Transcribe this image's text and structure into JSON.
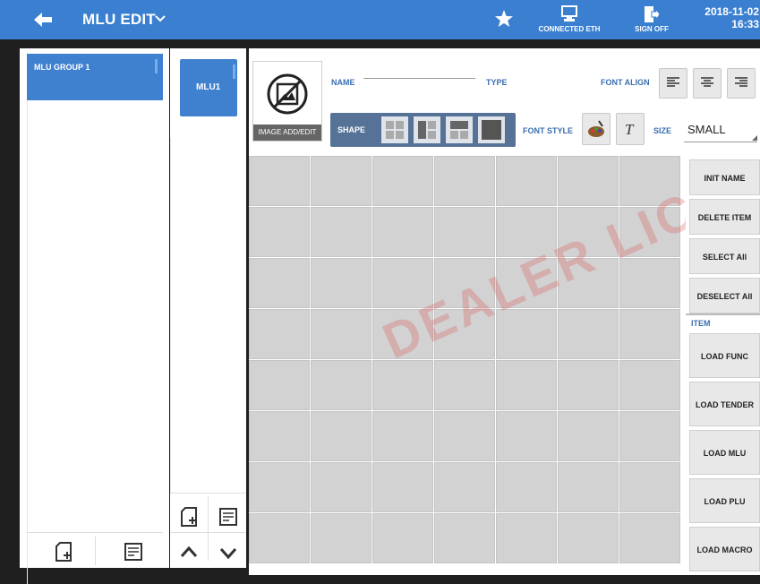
{
  "header": {
    "title": "MLU EDIT",
    "connection": "CONNECTED ETH",
    "signoff": "SIGN OFF",
    "date": "2018-11-02",
    "time": "16:33"
  },
  "groups": {
    "items": [
      {
        "label": "MLU GROUP 1"
      }
    ]
  },
  "mlus": {
    "items": [
      {
        "label": "MLU1"
      }
    ]
  },
  "editor": {
    "image_label": "IMAGE ADD/EDIT",
    "name_label": "NAME",
    "type_label": "TYPE",
    "font_align_label": "FONT ALIGN",
    "shape_label": "SHAPE",
    "font_style_label": "FONT STYLE",
    "size_label": "SIZE",
    "size_value": "SMALL"
  },
  "watermark": "DEALER LICENSE",
  "actions": {
    "init_name": "INIT NAME",
    "delete_item": "DELETE ITEM",
    "select_all": "SELECT All",
    "deselect_all": "DESELECT All",
    "item_label": "ITEM",
    "load_func": "LOAD FUNC",
    "load_tender": "LOAD TENDER",
    "load_mlu": "LOAD MLU",
    "load_plu": "LOAD PLU",
    "load_macro": "LOAD MACRO"
  },
  "colors": {
    "topbar": "#3a7fd0",
    "selected": "#3f80cf",
    "watermark": "#dc5050"
  }
}
